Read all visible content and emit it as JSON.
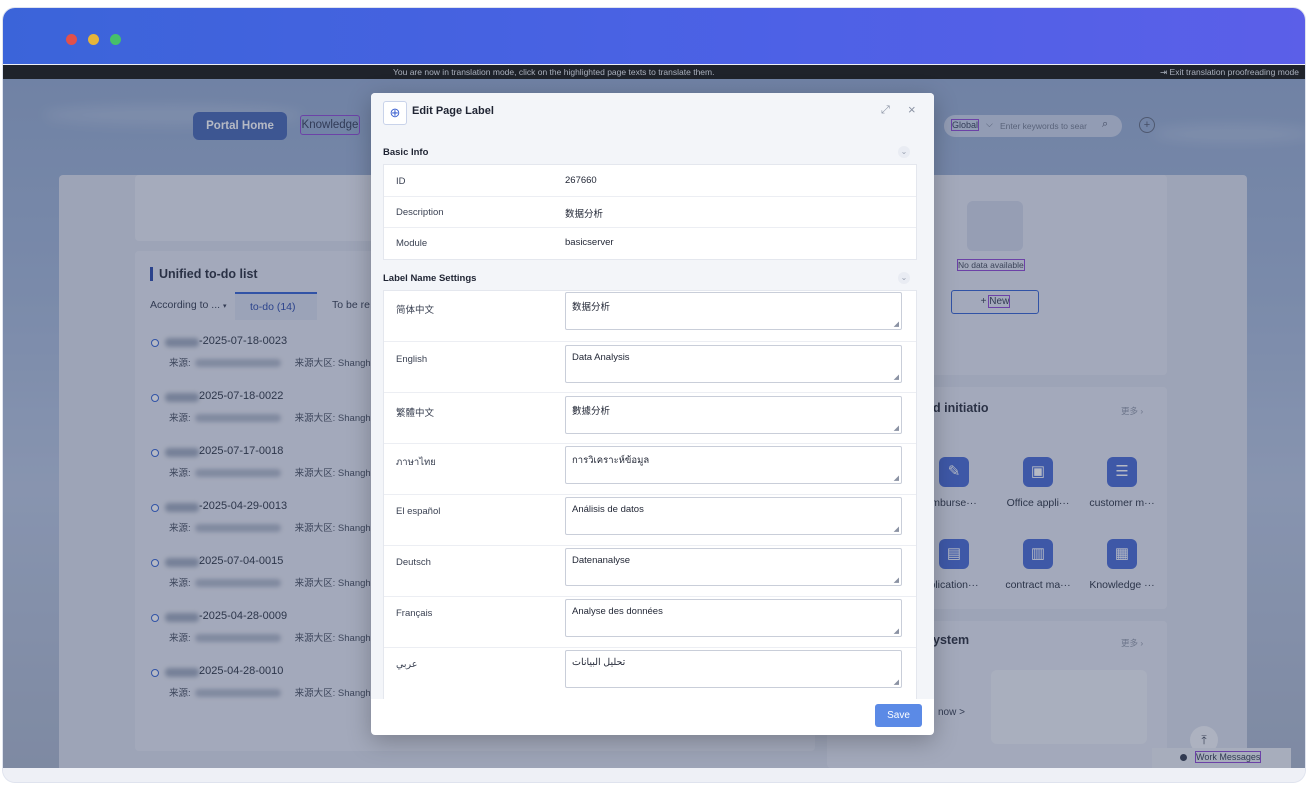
{
  "translation_bar": {
    "notice": "You are now in translation mode, click on the highlighted page texts to translate them.",
    "exit": "Exit translation proofreading mode"
  },
  "nav": {
    "portal_home": "Portal Home",
    "knowledge": "Knowledge",
    "global": "Global",
    "search_placeholder": "Enter keywords to sear"
  },
  "todo": {
    "title": "Unified to-do list",
    "filter": "According to ...",
    "tab_todo": "to-do (14)",
    "tab_tobe": "To be re",
    "source_label": "来源:",
    "region_label": "来源大区:",
    "region_value": "Shangha",
    "items": [
      {
        "no": "-2025-07-18-0023"
      },
      {
        "no": "2025-07-18-0022"
      },
      {
        "no": "2025-07-17-0018"
      },
      {
        "no": "-2025-04-29-0013"
      },
      {
        "no": "2025-07-04-0015"
      },
      {
        "no": "-2025-04-28-0009"
      },
      {
        "no": "2025-04-28-0010"
      }
    ]
  },
  "right_panel": {
    "no_data": "No data available",
    "new_btn": "New",
    "section_initiation": "d initiatio",
    "section_system": "ystem",
    "more": "更多",
    "apps_row1": [
      "mburse···",
      "Office appli···",
      "customer m···"
    ],
    "apps_row2": [
      "plication···",
      "contract ma···",
      "Knowledge ···"
    ],
    "now_link": "now >",
    "work_messages": "Work Messages",
    "back_top": "⤒"
  },
  "modal": {
    "title": "Edit Page Label",
    "basic_info": "Basic Info",
    "label_settings": "Label Name Settings",
    "save": "Save",
    "basic_rows": [
      {
        "label": "ID",
        "value": "267660"
      },
      {
        "label": "Description",
        "value": "数据分析"
      },
      {
        "label": "Module",
        "value": "basicserver"
      }
    ],
    "labels": [
      {
        "lang": "简体中文",
        "value": "数据分析"
      },
      {
        "lang": "English",
        "value": "Data Analysis"
      },
      {
        "lang": "繁體中文",
        "value": "數據分析"
      },
      {
        "lang": "ภาษาไทย",
        "value": "การวิเคราะห์ข้อมูล"
      },
      {
        "lang": "El español",
        "value": "Análisis de datos"
      },
      {
        "lang": "Deutsch",
        "value": "Datenanalyse"
      },
      {
        "lang": "Français",
        "value": "Analyse des données"
      },
      {
        "lang": "عربي",
        "value": "تحليل البيانات"
      }
    ]
  },
  "colors": {
    "titlebar": "#4a63e4",
    "accent": "#2b5bcf",
    "save": "#5b8ae6",
    "translation_highlight": "#8a3fd0"
  }
}
